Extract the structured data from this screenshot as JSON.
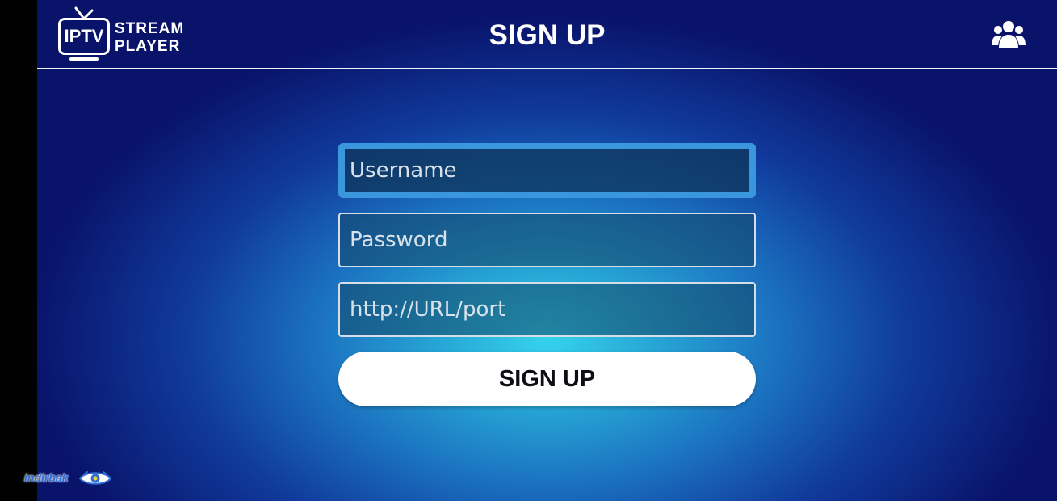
{
  "header": {
    "logo": {
      "badge_text": "IPTV",
      "line1": "STREAM",
      "line2": "PLAYER"
    },
    "title": "SIGN UP",
    "users_icon": "users-group-icon"
  },
  "form": {
    "username": {
      "placeholder": "Username",
      "value": ""
    },
    "password": {
      "placeholder": "Password",
      "value": ""
    },
    "url": {
      "placeholder": "http://URL/port",
      "value": ""
    },
    "submit_label": "SIGN UP"
  },
  "watermark": {
    "text": "indirbak",
    "icon": "eye-logo-icon"
  },
  "colors": {
    "background_center": "#35d3ec",
    "background_edge": "#09136a",
    "focus_border": "#3b97dd",
    "button_bg": "#ffffff"
  }
}
